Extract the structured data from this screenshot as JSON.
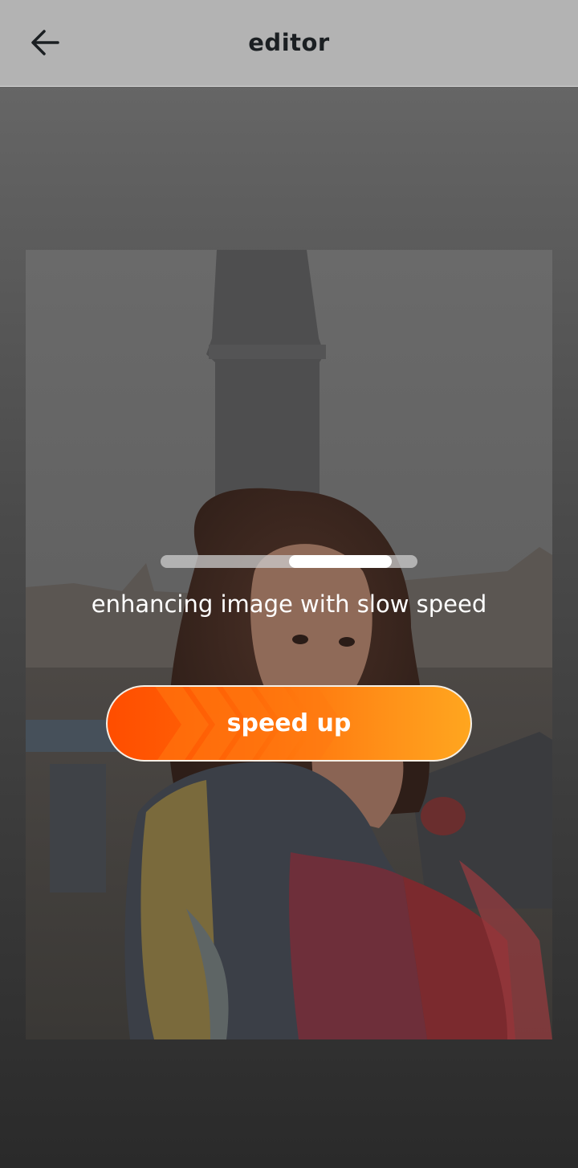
{
  "header": {
    "title": "editor",
    "back_icon": "arrow-left-icon"
  },
  "editor": {
    "status_text": "enhancing image with slow speed",
    "progress": {
      "start_fraction": 0.5,
      "end_fraction": 0.9
    },
    "speed_up_label": "speed up"
  },
  "colors": {
    "header_bg": "#b3b3b3",
    "button_start": "#ff4d00",
    "button_end": "#ffa61f"
  }
}
